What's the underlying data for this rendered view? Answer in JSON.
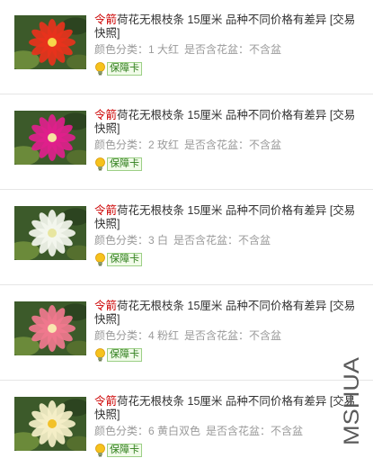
{
  "items": [
    {
      "title_prefix": "令箭",
      "title_rest": "荷花无根枝条 15厘米 品种不同价格有差异 [交易快照]",
      "color_label": "颜色分类：",
      "color_value": "1 大红",
      "pot_label": "是否含花盆：",
      "pot_value": "不含盆",
      "badge": "保障卡",
      "flower_color": "#e8321c",
      "flower_center": "#f7d64a"
    },
    {
      "title_prefix": "令箭",
      "title_rest": "荷花无根枝条 15厘米 品种不同价格有差异 [交易快照]",
      "color_label": "颜色分类：",
      "color_value": "2 玫红",
      "pot_label": "是否含花盆：",
      "pot_value": "不含盆",
      "badge": "保障卡",
      "flower_color": "#e0208c",
      "flower_center": "#f6e3a0"
    },
    {
      "title_prefix": "令箭",
      "title_rest": "荷花无根枝条 15厘米 品种不同价格有差异 [交易快照]",
      "color_label": "颜色分类：",
      "color_value": "3 白",
      "pot_label": "是否含花盆：",
      "pot_value": "不含盆",
      "badge": "保障卡",
      "flower_color": "#f4f6ee",
      "flower_center": "#e8e6a0"
    },
    {
      "title_prefix": "令箭",
      "title_rest": "荷花无根枝条 15厘米 品种不同价格有差异 [交易快照]",
      "color_label": "颜色分类：",
      "color_value": "4 粉红",
      "pot_label": "是否含花盆：",
      "pot_value": "不含盆",
      "badge": "保障卡",
      "flower_color": "#f0788e",
      "flower_center": "#f9e6b0"
    },
    {
      "title_prefix": "令箭",
      "title_rest": "荷花无根枝条 15厘米 品种不同价格有差异 [交易快照]",
      "color_label": "颜色分类：",
      "color_value": "6 黄白双色",
      "pot_label": "是否含花盆：",
      "pot_value": "不含盆",
      "badge": "保障卡",
      "flower_color": "#f5efc8",
      "flower_center": "#f2c12a"
    }
  ],
  "watermark": "MSHUA"
}
